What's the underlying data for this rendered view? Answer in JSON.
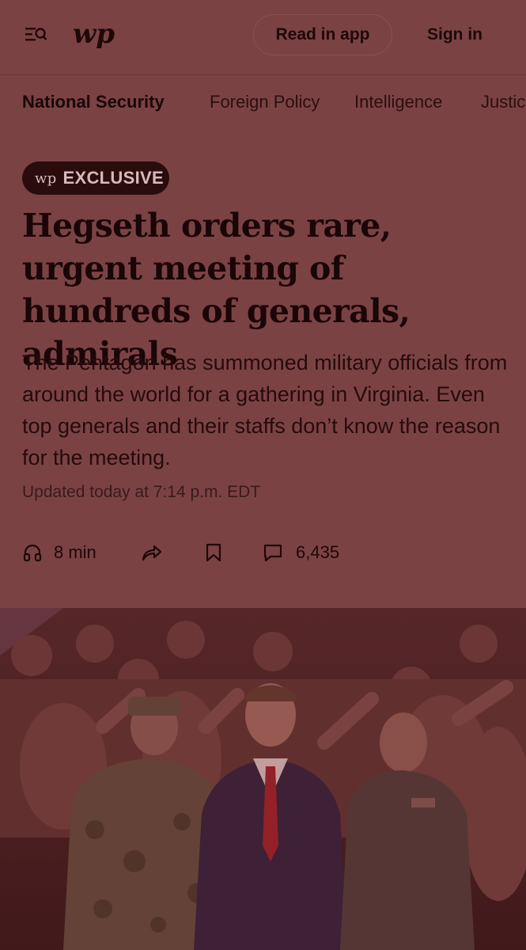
{
  "header": {
    "menu_icon": "menu-search-icon",
    "logo_text": "wp",
    "read_in_app": "Read in app",
    "sign_in": "Sign in"
  },
  "subnav": {
    "items": [
      "National Security",
      "Foreign Policy",
      "Intelligence",
      "Justice"
    ]
  },
  "article": {
    "badge": "EXCLUSIVE",
    "badge_logo": "wp",
    "headline": "Hegseth orders rare, urgent meeting of hundreds of generals, admirals",
    "dek": "The Pentagon has summoned military officials from around the world for a gathering in Virginia. Even top generals and their staffs don’t know the reason for the meeting.",
    "updated": "Updated today at 7:14 p.m. EDT",
    "listen_time": "8 min",
    "comment_count": "6,435"
  },
  "icons": {
    "listen": "headphones-icon",
    "share": "share-icon",
    "save": "bookmark-icon",
    "comments": "comment-icon"
  },
  "colors": {
    "overlay": "#7b4244",
    "text": "#1e0808",
    "badge_bg": "#2a0c0d"
  }
}
